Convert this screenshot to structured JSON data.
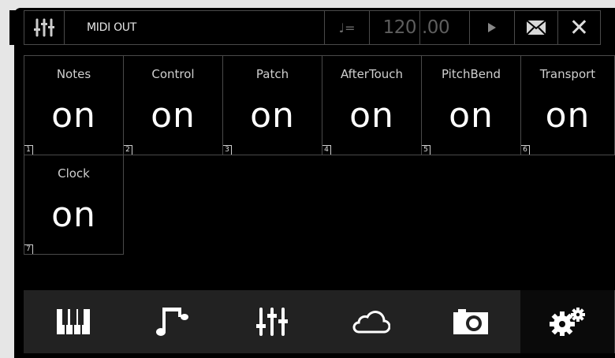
{
  "header": {
    "title": "MIDI OUT",
    "tempo_symbol": "♩=",
    "tempo_integer": "120",
    "tempo_fraction": ".00",
    "icons": [
      "mixer-icon",
      "play-icon",
      "mail-icon",
      "close-icon"
    ],
    "close_symbol": "✕"
  },
  "cells": [
    {
      "label": "Notes",
      "value": "on",
      "index": "1"
    },
    {
      "label": "Control",
      "value": "on",
      "index": "2"
    },
    {
      "label": "Patch",
      "value": "on",
      "index": "3"
    },
    {
      "label": "AfterTouch",
      "value": "on",
      "index": "4"
    },
    {
      "label": "PitchBend",
      "value": "on",
      "index": "5"
    },
    {
      "label": "Transport",
      "value": "on",
      "index": "6"
    },
    {
      "label": "Clock",
      "value": "on",
      "index": "7"
    }
  ],
  "nav": {
    "items": [
      "keyboard-icon",
      "music-notes-icon",
      "mixer-icon",
      "cloud-icon",
      "camera-icon",
      "gears-icon"
    ],
    "active": "gears-icon"
  },
  "colors": {
    "background": "#000000",
    "border": "#4a4a4a",
    "nav_background": "#222222",
    "text": "#ffffff",
    "dim_text": "#5e5e5e"
  }
}
